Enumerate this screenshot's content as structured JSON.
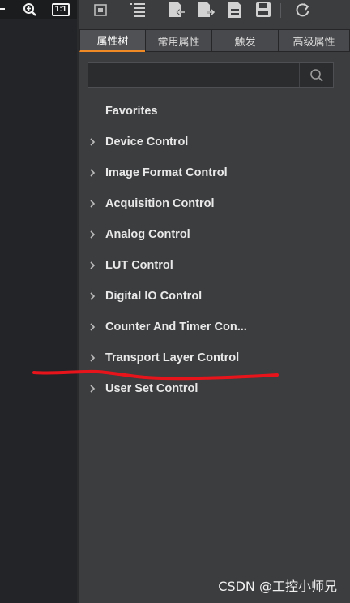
{
  "left_toolbar": {
    "zoom_icon": "zoom-in-icon",
    "one_to_one_label": "1:1"
  },
  "toolbar": {
    "icons": [
      "frame-icon",
      "list-icon",
      "import-icon",
      "export-icon",
      "document-icon",
      "save-icon",
      "refresh-icon"
    ]
  },
  "tabs": [
    {
      "label": "属性树",
      "active": true
    },
    {
      "label": "常用属性",
      "active": false
    },
    {
      "label": "触发",
      "active": false
    },
    {
      "label": "高级属性",
      "active": false
    }
  ],
  "search": {
    "value": "",
    "placeholder": ""
  },
  "tree": {
    "favorites": "Favorites",
    "items": [
      {
        "label": "Device Control"
      },
      {
        "label": "Image Format Control"
      },
      {
        "label": "Acquisition Control"
      },
      {
        "label": "Analog Control"
      },
      {
        "label": "LUT Control"
      },
      {
        "label": "Digital IO Control"
      },
      {
        "label": "Counter And Timer Con..."
      },
      {
        "label": "Transport Layer Control"
      },
      {
        "label": "User Set Control"
      }
    ]
  },
  "annotation_color": "#e8141c",
  "accent_color": "#f08a24",
  "watermark": "CSDN @工控小师兄"
}
